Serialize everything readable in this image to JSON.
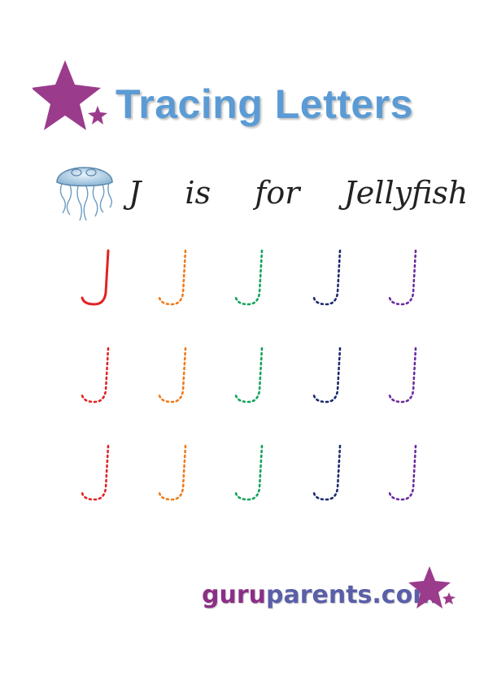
{
  "title": "Tracing Letters",
  "subtitle": {
    "letter": "J",
    "is": "is",
    "for": "for",
    "word": "Jellyfish"
  },
  "tracing_letter": "J",
  "row_colors": [
    "#e32222",
    "#f07b1a",
    "#12a35a",
    "#1b2a6b",
    "#6b2aa0"
  ],
  "colors": {
    "title": "#5b9bd5",
    "star": "#9b3b8c",
    "footer_guru": "#8b2f86",
    "footer_parents": "#5a5fa8"
  },
  "footer": {
    "part1": "guru",
    "part2": "parents.com"
  },
  "icons": [
    "star-icon",
    "jellyfish-icon"
  ]
}
